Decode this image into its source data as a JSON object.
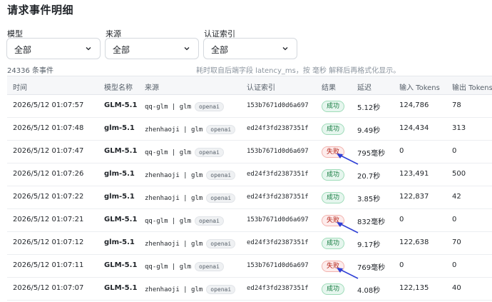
{
  "page": {
    "title": "请求事件明细"
  },
  "filters": [
    {
      "label": "模型",
      "value": "全部"
    },
    {
      "label": "来源",
      "value": "全部"
    },
    {
      "label": "认证索引",
      "value": "全部"
    }
  ],
  "summary": {
    "count": "24336 条事件",
    "hint": "耗时取自后端字段 latency_ms，按 毫秒 解释后再格式化显示。"
  },
  "table": {
    "headers": [
      "时间",
      "模型名称",
      "来源",
      "认证索引",
      "结果",
      "延迟",
      "输入 Tokens",
      "输出 Tokens"
    ],
    "rows": [
      {
        "time": "2026/5/12 01:07:57",
        "model": "GLM-5.1",
        "source": "qq-glm | glm",
        "tag": "openai",
        "auth": "153b7671d0d6a697",
        "result": "成功",
        "status": "ok",
        "latency": "5.12秒",
        "input": "124,786",
        "output": "78"
      },
      {
        "time": "2026/5/12 01:07:48",
        "model": "glm-5.1",
        "source": "zhenhaoji | glm",
        "tag": "openai",
        "auth": "ed24f3fd2387351f",
        "result": "成功",
        "status": "ok",
        "latency": "9.49秒",
        "input": "124,434",
        "output": "313"
      },
      {
        "time": "2026/5/12 01:07:47",
        "model": "GLM-5.1",
        "source": "qq-glm | glm",
        "tag": "openai",
        "auth": "153b7671d0d6a697",
        "result": "失败",
        "status": "fail",
        "latency": "795毫秒",
        "input": "0",
        "output": "0"
      },
      {
        "time": "2026/5/12 01:07:26",
        "model": "glm-5.1",
        "source": "zhenhaoji | glm",
        "tag": "openai",
        "auth": "ed24f3fd2387351f",
        "result": "成功",
        "status": "ok",
        "latency": "20.7秒",
        "input": "123,491",
        "output": "500"
      },
      {
        "time": "2026/5/12 01:07:22",
        "model": "glm-5.1",
        "source": "zhenhaoji | glm",
        "tag": "openai",
        "auth": "ed24f3fd2387351f",
        "result": "成功",
        "status": "ok",
        "latency": "3.85秒",
        "input": "122,837",
        "output": "42"
      },
      {
        "time": "2026/5/12 01:07:21",
        "model": "GLM-5.1",
        "source": "qq-glm | glm",
        "tag": "openai",
        "auth": "153b7671d0d6a697",
        "result": "失败",
        "status": "fail",
        "latency": "832毫秒",
        "input": "0",
        "output": "0"
      },
      {
        "time": "2026/5/12 01:07:12",
        "model": "glm-5.1",
        "source": "zhenhaoji | glm",
        "tag": "openai",
        "auth": "ed24f3fd2387351f",
        "result": "成功",
        "status": "ok",
        "latency": "9.17秒",
        "input": "122,638",
        "output": "70"
      },
      {
        "time": "2026/5/12 01:07:11",
        "model": "GLM-5.1",
        "source": "qq-glm | glm",
        "tag": "openai",
        "auth": "153b7671d0d6a697",
        "result": "失败",
        "status": "fail",
        "latency": "769毫秒",
        "input": "0",
        "output": "0"
      },
      {
        "time": "2026/5/12 01:07:07",
        "model": "GLM-5.1",
        "source": "zhenhaoji | glm",
        "tag": "openai",
        "auth": "ed24f3fd2387351f",
        "result": "成功",
        "status": "ok",
        "latency": "4.08秒",
        "input": "122,135",
        "output": "40"
      }
    ]
  },
  "colors": {
    "success_bg": "#e6f6ee",
    "success_text": "#137a3e",
    "fail_bg": "#fdecec",
    "fail_text": "#b42318",
    "annotation_arrow": "#2f3fd6"
  },
  "icons": {
    "select_chevron": "chevron-down-icon",
    "annotation": "arrow-annotation-icon"
  }
}
